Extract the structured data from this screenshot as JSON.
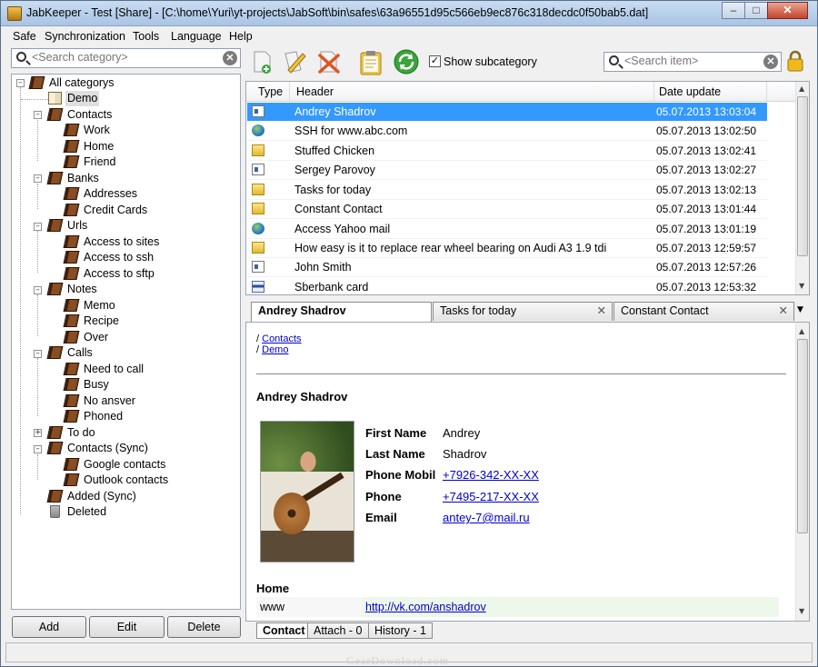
{
  "window": {
    "title": "JabKeeper - Test [Share] - [C:\\home\\Yuri\\yt-projects\\JabSoft\\bin\\safes\\63a96551d95c566eb9ec876c318decdc0f50bab5.dat]",
    "minimize_glyph": "–",
    "maximize_glyph": "□",
    "close_glyph": "✕"
  },
  "menu": [
    "Safe",
    "Synchronization",
    "Tools",
    "Language",
    "Help"
  ],
  "category_search": {
    "placeholder": "<Search category>",
    "clear_glyph": "✕"
  },
  "item_search": {
    "placeholder": "<Search item>",
    "clear_glyph": "✕"
  },
  "tree": [
    {
      "label": "All categorys",
      "icon": "book-icon"
    },
    {
      "label": "Demo",
      "icon": "open-book-icon",
      "selected": true
    },
    {
      "label": "Contacts",
      "icon": "book-icon"
    },
    {
      "label": "Work",
      "icon": "book-icon"
    },
    {
      "label": "Home",
      "icon": "book-icon"
    },
    {
      "label": "Friend",
      "icon": "book-icon"
    },
    {
      "label": "Banks",
      "icon": "book-icon"
    },
    {
      "label": "Addresses",
      "icon": "book-icon"
    },
    {
      "label": "Credit Cards",
      "icon": "book-icon"
    },
    {
      "label": "Urls",
      "icon": "book-icon"
    },
    {
      "label": "Access to sites",
      "icon": "book-icon"
    },
    {
      "label": "Access to ssh",
      "icon": "book-icon"
    },
    {
      "label": "Access to sftp",
      "icon": "book-icon"
    },
    {
      "label": "Notes",
      "icon": "book-icon"
    },
    {
      "label": "Memo",
      "icon": "book-icon"
    },
    {
      "label": "Recipe",
      "icon": "book-icon"
    },
    {
      "label": "Over",
      "icon": "book-icon"
    },
    {
      "label": "Calls",
      "icon": "book-icon"
    },
    {
      "label": "Need to call",
      "icon": "book-icon"
    },
    {
      "label": "Busy",
      "icon": "book-icon"
    },
    {
      "label": "No ansver",
      "icon": "book-icon"
    },
    {
      "label": "Phoned",
      "icon": "book-icon"
    },
    {
      "label": "To do",
      "icon": "book-icon"
    },
    {
      "label": "Contacts (Sync)",
      "icon": "book-icon"
    },
    {
      "label": "Google contacts",
      "icon": "book-icon"
    },
    {
      "label": "Outlook contacts",
      "icon": "book-icon"
    },
    {
      "label": "Added (Sync)",
      "icon": "book-icon"
    },
    {
      "label": "Deleted",
      "icon": "trash-icon"
    }
  ],
  "tree_buttons": {
    "add": "Add",
    "edit": "Edit",
    "delete": "Delete"
  },
  "toolbar": {
    "show_subcategory_label": "Show subcategory",
    "show_subcategory_checked": true,
    "check_glyph": "✓",
    "icons": [
      "new-item-icon",
      "edit-item-icon",
      "delete-item-icon",
      "clipboard-icon",
      "sync-icon",
      "lock-icon"
    ]
  },
  "list": {
    "columns": {
      "type": "Type",
      "header": "Header",
      "date": "Date update"
    },
    "rows": [
      {
        "icon": "contact-card-icon",
        "header": "Andrey  Shadrov",
        "date": "05.07.2013 13:03:04",
        "selected": true
      },
      {
        "icon": "globe-icon",
        "header": "SSH for  www.abc.com",
        "date": "05.07.2013 13:02:50"
      },
      {
        "icon": "note-icon",
        "header": "Stuffed Chicken",
        "date": "05.07.2013 13:02:41"
      },
      {
        "icon": "contact-card-icon",
        "header": "Sergey  Parovoy",
        "date": "05.07.2013 13:02:27"
      },
      {
        "icon": "note-icon",
        "header": "Tasks for today",
        "date": "05.07.2013 13:02:13"
      },
      {
        "icon": "note-icon",
        "header": "Constant Contact",
        "date": "05.07.2013 13:01:44"
      },
      {
        "icon": "globe-icon",
        "header": "Access Yahoo mail",
        "date": "05.07.2013 13:01:19"
      },
      {
        "icon": "note-icon",
        "header": "How easy is it to replace rear wheel bearing on Audi A3 1.9 tdi",
        "date": "05.07.2013 12:59:57"
      },
      {
        "icon": "contact-card-icon",
        "header": "John  Smith",
        "date": "05.07.2013 12:57:26"
      },
      {
        "icon": "visa-card-icon",
        "header": "Sberbank card",
        "date": "05.07.2013 12:53:32"
      }
    ]
  },
  "detail_tabs": [
    {
      "label": "Andrey  Shadrov",
      "active": true
    },
    {
      "label": "Tasks for today",
      "close": "✕"
    },
    {
      "label": "Constant Contact",
      "close": "✕"
    }
  ],
  "detail": {
    "breadcrumb_sep": "/",
    "breadcrumbs": [
      "Contacts",
      "Demo"
    ],
    "name": "Andrey  Shadrov",
    "fields": [
      {
        "label": "First Name",
        "value": "Andrey",
        "link": false
      },
      {
        "label": "Last Name",
        "value": "Shadrov",
        "link": false
      },
      {
        "label": "Phone Mobil",
        "value": "+7926-342-XX-XX",
        "link": true
      },
      {
        "label": "Phone",
        "value": "+7495-217-XX-XX",
        "link": true
      },
      {
        "label": "Email",
        "value": "antey-7@mail.ru",
        "link": true
      }
    ],
    "section": "Home",
    "www_label": "www",
    "www_value": "http://vk.com/anshadrov"
  },
  "bottom_tabs": [
    {
      "label": "Contact",
      "active": true
    },
    {
      "label": "Attach - 0"
    },
    {
      "label": "History - 1"
    }
  ],
  "watermark": "GearDownload.com"
}
